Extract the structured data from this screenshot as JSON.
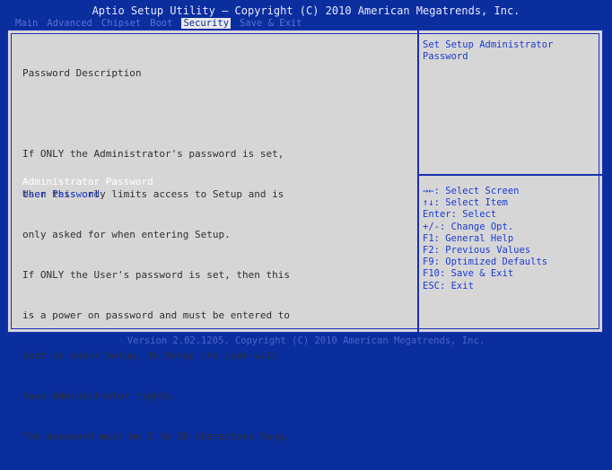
{
  "header": {
    "title": "Aptio Setup Utility – Copyright (C) 2010 American Megatrends, Inc."
  },
  "menu": {
    "tabs": [
      {
        "label": "Main"
      },
      {
        "label": "Advanced"
      },
      {
        "label": "Chipset"
      },
      {
        "label": "Boot"
      },
      {
        "label": "Security"
      },
      {
        "label": "Save & Exit"
      }
    ],
    "active_tab": "Security"
  },
  "main": {
    "section_title": "Password Description",
    "description": [
      "If ONLY the Administrator's password is set,",
      "then this only limits access to Setup and is",
      "only asked for when entering Setup.",
      "If ONLY the User's password is set, then this",
      "is a power on password and must be entered to",
      "boot or enter Setup. In Setup the User will",
      "have Administrator rights.",
      "The password must be 3 to 20 characters long."
    ],
    "options": [
      {
        "label": "Administrator Password",
        "selected": true
      },
      {
        "label": "User Password",
        "selected": false
      }
    ]
  },
  "help": {
    "text": "Set Setup Administrator Password"
  },
  "keys": [
    {
      "key": "→←",
      "text": ": Select Screen"
    },
    {
      "key": "↑↓",
      "text": ": Select Item"
    },
    {
      "key": "Enter",
      "text": ": Select"
    },
    {
      "key": "+/-",
      "text": ": Change Opt."
    },
    {
      "key": "F1",
      "text": ": General Help"
    },
    {
      "key": "F2",
      "text": ": Previous Values"
    },
    {
      "key": "F9",
      "text": ": Optimized Defaults"
    },
    {
      "key": "F10",
      "text": ": Save & Exit"
    },
    {
      "key": "ESC",
      "text": ": Exit"
    }
  ],
  "footer": {
    "text": "Version 2.02.1205. Copyright (C) 2010 American Megatrends, Inc."
  },
  "colors": {
    "background": "#0a2e9e",
    "panel": "#d6d6d6",
    "highlight_text": "#ffffff",
    "option_text": "#1d3bd0"
  }
}
